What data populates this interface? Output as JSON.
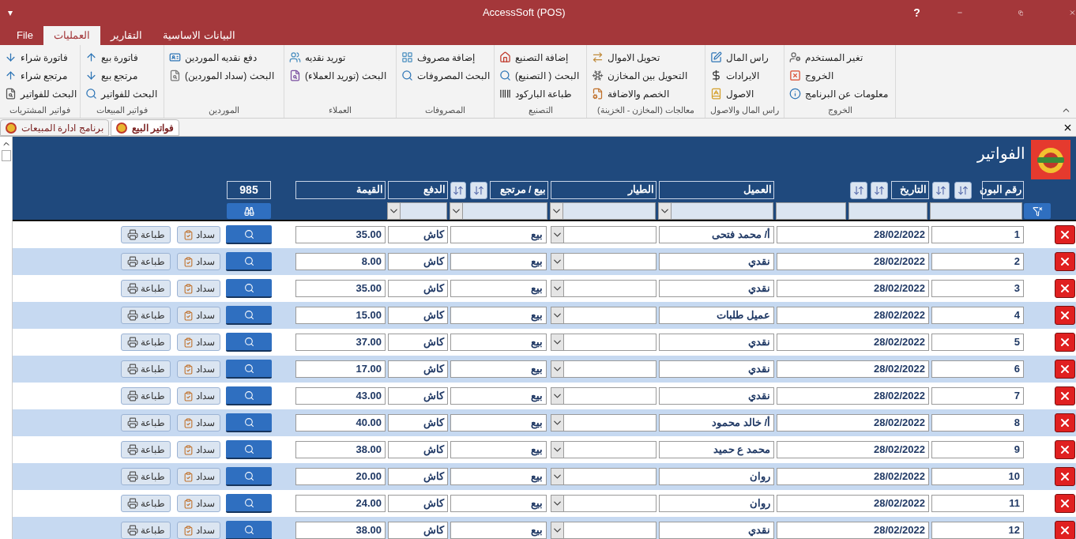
{
  "window": {
    "title": "AccessSoft (POS)",
    "menu_glyph": "▾",
    "help": "?"
  },
  "ribbon_tabs": [
    {
      "label": "البيانات الاساسية",
      "selected": false
    },
    {
      "label": "التقارير",
      "selected": false
    },
    {
      "label": "العمليات",
      "selected": true
    },
    {
      "label": "File",
      "selected": false
    }
  ],
  "ribbon_groups": [
    {
      "label": "الخروج",
      "items": [
        "تغير المستخدم",
        "الخروج",
        "معلومات عن البرنامج"
      ]
    },
    {
      "label": "راس المال والاصول",
      "items": [
        "راس المال",
        "الايرادات",
        "الاصول"
      ]
    },
    {
      "label": "معالجات (المخازن - الخزينة)",
      "items": [
        "تحويل الاموال",
        "التحويل بين المخازن",
        "الخصم والاضافة"
      ]
    },
    {
      "label": "التصنيع",
      "items": [
        "إضافة التصنيع",
        "البحث ( التصنيع)",
        "طباعة الباركود"
      ]
    },
    {
      "label": "المصروفات",
      "items": [
        "إضافة مصروف",
        "البحث المصروفات"
      ]
    },
    {
      "label": "العملاء",
      "items": [
        "توريد نقديه",
        "البحث (توريد العملاء)"
      ]
    },
    {
      "label": "الموردين",
      "items": [
        "دفع نقديه الموردين",
        "البحث (سداد الموردين)"
      ]
    },
    {
      "label": "فواتير المبيعات",
      "items": [
        "فاتورة بيع",
        "مرتجع بيع",
        "البحث للفواتير"
      ]
    },
    {
      "label": "فواتير المشتريات",
      "items": [
        "فاتورة شراء",
        "مرتجع شراء",
        "البحث للفواتير"
      ]
    }
  ],
  "document_tabs": [
    {
      "label": "فواتير البيع",
      "selected": true
    },
    {
      "label": "برنامج ادارة المبيعات",
      "selected": false
    }
  ],
  "form": {
    "title": "الفواتير",
    "count": "985",
    "columns": {
      "number": "رقم البون",
      "date": "التاريخ",
      "customer": "العميل",
      "courier": "الطيار",
      "type": "بيع / مرتجع",
      "payment": "الدفع",
      "value": "القيمة"
    },
    "rows": [
      {
        "number": "1",
        "date": "28/02/2022",
        "customer": "أ/ محمد فتحى",
        "type": "بيع",
        "payment": "كاش",
        "value": "35.00",
        "pay_button": "سداد",
        "print_button": "طباعة"
      },
      {
        "number": "2",
        "date": "28/02/2022",
        "customer": "نقدي",
        "type": "بيع",
        "payment": "كاش",
        "value": "8.00",
        "pay_button": "سداد",
        "print_button": "طباعة"
      },
      {
        "number": "3",
        "date": "28/02/2022",
        "customer": "نقدي",
        "type": "بيع",
        "payment": "كاش",
        "value": "35.00",
        "pay_button": "سداد",
        "print_button": "طباعة"
      },
      {
        "number": "4",
        "date": "28/02/2022",
        "customer": "عميل طلبات",
        "type": "بيع",
        "payment": "كاش",
        "value": "15.00",
        "pay_button": "سداد",
        "print_button": "طباعة"
      },
      {
        "number": "5",
        "date": "28/02/2022",
        "customer": "نقدي",
        "type": "بيع",
        "payment": "كاش",
        "value": "37.00",
        "pay_button": "سداد",
        "print_button": "طباعة"
      },
      {
        "number": "6",
        "date": "28/02/2022",
        "customer": "نقدي",
        "type": "بيع",
        "payment": "كاش",
        "value": "17.00",
        "pay_button": "سداد",
        "print_button": "طباعة"
      },
      {
        "number": "7",
        "date": "28/02/2022",
        "customer": "نقدي",
        "type": "بيع",
        "payment": "كاش",
        "value": "43.00",
        "pay_button": "سداد",
        "print_button": "طباعة"
      },
      {
        "number": "8",
        "date": "28/02/2022",
        "customer": "أ/ خالد محمود",
        "type": "بيع",
        "payment": "كاش",
        "value": "40.00",
        "pay_button": "سداد",
        "print_button": "طباعة"
      },
      {
        "number": "9",
        "date": "28/02/2022",
        "customer": "محمد ع حميد",
        "type": "بيع",
        "payment": "كاش",
        "value": "38.00",
        "pay_button": "سداد",
        "print_button": "طباعة"
      },
      {
        "number": "10",
        "date": "28/02/2022",
        "customer": "روان",
        "type": "بيع",
        "payment": "كاش",
        "value": "20.00",
        "pay_button": "سداد",
        "print_button": "طباعة"
      },
      {
        "number": "11",
        "date": "28/02/2022",
        "customer": "روان",
        "type": "بيع",
        "payment": "كاش",
        "value": "24.00",
        "pay_button": "سداد",
        "print_button": "طباعة"
      },
      {
        "number": "12",
        "date": "28/02/2022",
        "customer": "نقدي",
        "type": "بيع",
        "payment": "كاش",
        "value": "38.00",
        "pay_button": "سداد",
        "print_button": "طباعة"
      }
    ]
  }
}
